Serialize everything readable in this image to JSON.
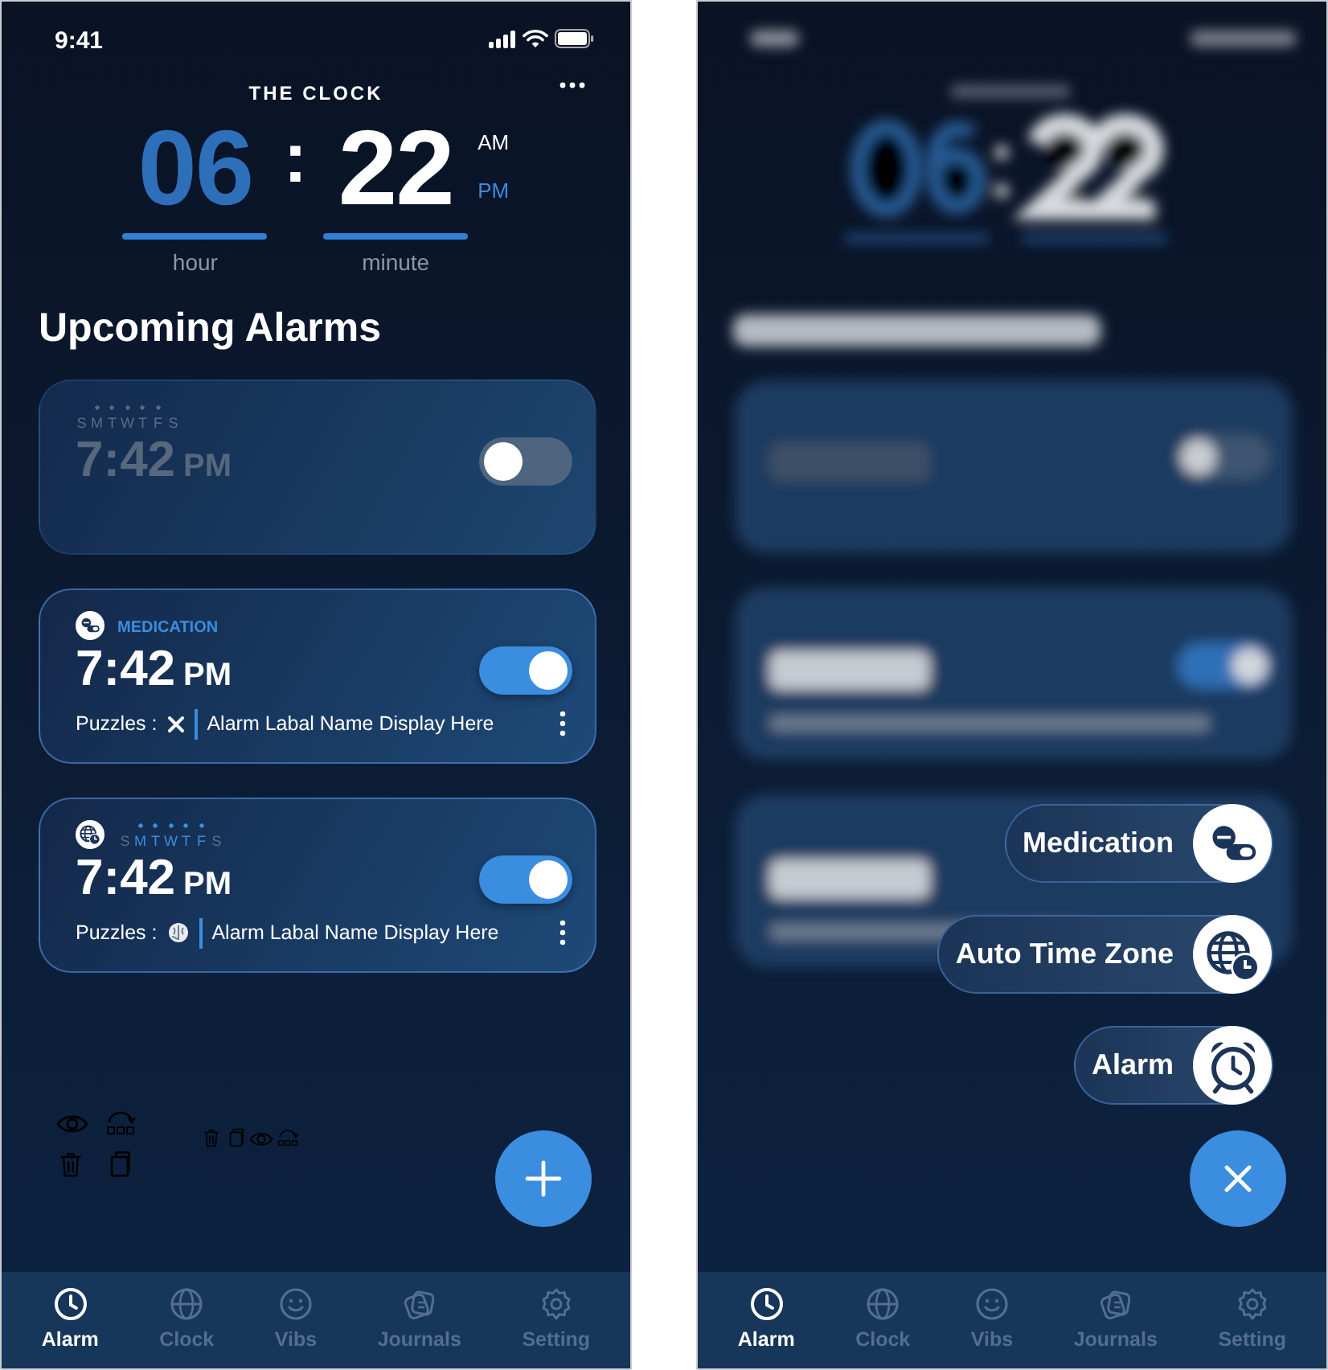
{
  "main_screen": {
    "status_bar": {
      "time": "9:41"
    },
    "app_title": "THE CLOCK",
    "clock": {
      "hour": "06",
      "separator": ":",
      "minute": "22",
      "periods": [
        {
          "label": "AM",
          "selected": false
        },
        {
          "label": "PM",
          "selected": true
        }
      ],
      "hour_label": "hour",
      "minute_label": "minute"
    },
    "section_title": "Upcoming Alarms",
    "alarms": [
      {
        "kind": "plain",
        "enabled": false,
        "days": [
          {
            "letter": "S",
            "active": false
          },
          {
            "letter": "M",
            "active": true
          },
          {
            "letter": "T",
            "active": true
          },
          {
            "letter": "W",
            "active": true
          },
          {
            "letter": "T",
            "active": true
          },
          {
            "letter": "F",
            "active": true
          },
          {
            "letter": "S",
            "active": false
          }
        ],
        "time": "7:42",
        "period": "PM"
      },
      {
        "kind": "medication",
        "enabled": true,
        "tag": "MEDICATION",
        "time": "7:42",
        "period": "PM",
        "puzzles_label": "Puzzles :",
        "has_puzzle": false,
        "label": "Alarm Labal Name Display Here"
      },
      {
        "kind": "timezone",
        "enabled": true,
        "days": [
          {
            "letter": "S",
            "active": false
          },
          {
            "letter": "M",
            "active": true
          },
          {
            "letter": "T",
            "active": true
          },
          {
            "letter": "W",
            "active": true
          },
          {
            "letter": "T",
            "active": true
          },
          {
            "letter": "F",
            "active": true
          },
          {
            "letter": "S",
            "active": false
          }
        ],
        "time": "7:42",
        "period": "PM",
        "puzzles_label": "Puzzles :",
        "has_puzzle": true,
        "label": "Alarm Labal Name Display Here"
      }
    ],
    "tabs": [
      {
        "label": "Alarm",
        "selected": true
      },
      {
        "label": "Clock",
        "selected": false
      },
      {
        "label": "Vibs",
        "selected": false
      },
      {
        "label": "Journals",
        "selected": false
      },
      {
        "label": "Setting",
        "selected": false
      }
    ]
  },
  "menu_screen": {
    "options": [
      {
        "kind": "medication",
        "label": "Medication"
      },
      {
        "kind": "timezone",
        "label": "Auto Time Zone"
      },
      {
        "kind": "alarm",
        "label": "Alarm"
      }
    ],
    "tabs": [
      {
        "label": "Alarm",
        "selected": true
      },
      {
        "label": "Clock",
        "selected": false
      },
      {
        "label": "Vibs",
        "selected": false
      },
      {
        "label": "Journals",
        "selected": false
      },
      {
        "label": "Setting",
        "selected": false
      }
    ]
  }
}
